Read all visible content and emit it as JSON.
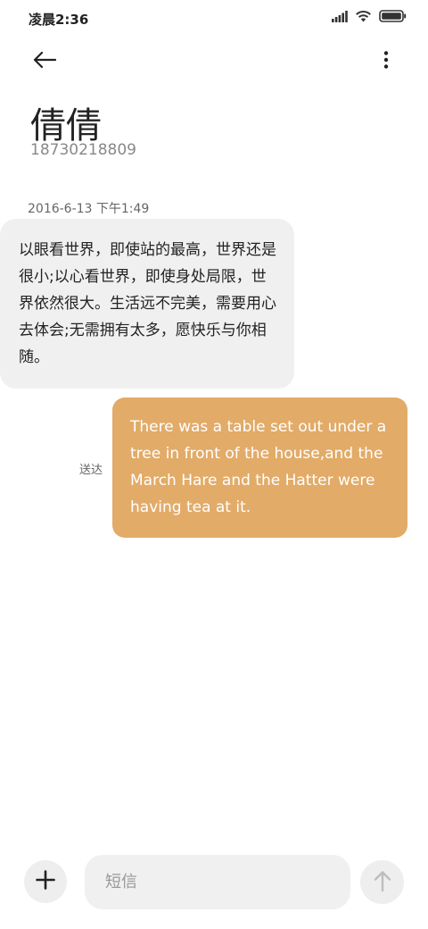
{
  "status_bar": {
    "time": "凌晨2:36",
    "icons": [
      "signal-icon",
      "wifi-icon",
      "battery-icon"
    ]
  },
  "header": {
    "back_icon": "back-arrow-icon",
    "more_icon": "more-vertical-icon",
    "contact_name": "倩倩",
    "contact_number": "18730218809"
  },
  "conversation": {
    "timestamp": "2016-6-13 下午1:49",
    "messages": [
      {
        "direction": "incoming",
        "text": "以眼看世界，即使站的最高，世界还是很小;以心看世界，即使身处局限，世界依然很大。生活远不完美，需要用心去体会;无需拥有太多，愿快乐与你相随。"
      },
      {
        "direction": "outgoing",
        "text": "There was a table set out under a tree in front of the house,and the March Hare and the Hatter were having tea at it.",
        "status": "送达"
      }
    ]
  },
  "composer": {
    "add_icon": "plus-icon",
    "input_placeholder": "短信",
    "input_value": "",
    "send_icon": "send-arrow-icon"
  },
  "colors": {
    "outgoing_bubble": "#e2ab68",
    "incoming_bubble": "#f0f0f0",
    "background": "#ffffff"
  }
}
